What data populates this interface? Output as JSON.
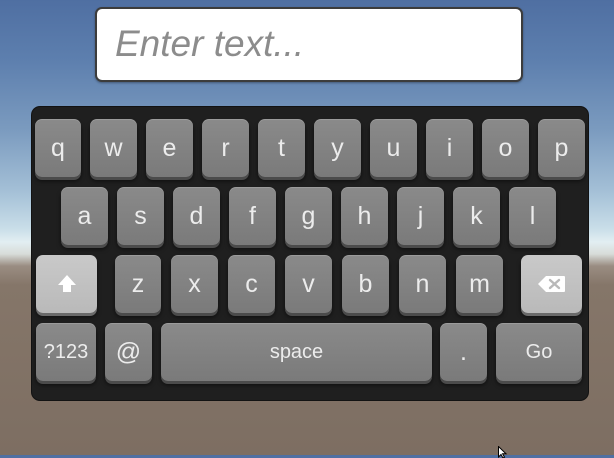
{
  "input": {
    "placeholder": "Enter text...",
    "value": ""
  },
  "keyboard": {
    "row1": [
      "q",
      "w",
      "e",
      "r",
      "t",
      "y",
      "u",
      "i",
      "o",
      "p"
    ],
    "row2": [
      "a",
      "s",
      "d",
      "f",
      "g",
      "h",
      "j",
      "k",
      "l"
    ],
    "row3": [
      "z",
      "x",
      "c",
      "v",
      "b",
      "n",
      "m"
    ],
    "shift_icon": "shift-arrow-icon",
    "backspace_icon": "backspace-icon",
    "symbols_label": "?123",
    "at_label": "@",
    "space_label": "space",
    "period_label": ".",
    "go_label": "Go"
  }
}
